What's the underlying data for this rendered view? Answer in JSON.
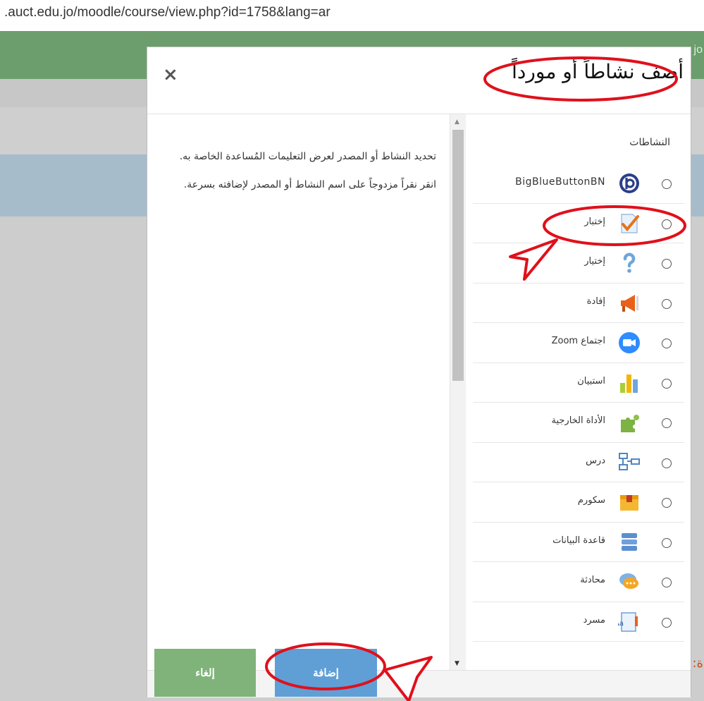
{
  "browser": {
    "url": ".auct.edu.jo/moodle/course/view.php?id=1758&lang=ar"
  },
  "background": {
    "header_peek": "jo",
    "bottom_text": "ة: أحد أنواع الأسئلة التي يستخدمها المعلم في بناء الاختبار يتضمن نص السؤال والخيارات بالإ"
  },
  "modal": {
    "title": "أضف نشاطاً أو مورداً",
    "close_glyph": "×",
    "help_text": "تحديد النشاط أو المصدر لعرض التعليمات المُساعدة الخاصة به. انقر نقراً مزدوجاً على اسم النشاط أو المصدر لإضافته بسرعة.",
    "section_label": "النشاطات",
    "options": [
      {
        "label": "BigBlueButtonBN",
        "icon": "bigbluebutton-icon"
      },
      {
        "label": "إختبار",
        "icon": "quiz-icon"
      },
      {
        "label": "إختيار",
        "icon": "choice-icon"
      },
      {
        "label": "إفادة",
        "icon": "feedback-icon"
      },
      {
        "label": "اجتماع Zoom",
        "icon": "zoom-icon"
      },
      {
        "label": "استبيان",
        "icon": "survey-icon"
      },
      {
        "label": "الأداة الخارجية",
        "icon": "external-tool-icon"
      },
      {
        "label": "درس",
        "icon": "lesson-icon"
      },
      {
        "label": "سكورم",
        "icon": "scorm-icon"
      },
      {
        "label": "قاعدة البيانات",
        "icon": "database-icon"
      },
      {
        "label": "محادثة",
        "icon": "chat-icon"
      },
      {
        "label": "مسرد",
        "icon": "glossary-icon"
      }
    ],
    "buttons": {
      "cancel": "إلغاء",
      "add": "إضافة"
    }
  },
  "colors": {
    "header_green": "#6b9e6c",
    "cancel_green": "#7fb37a",
    "add_blue": "#5f9fd6",
    "annotation_red": "#e0101b"
  }
}
